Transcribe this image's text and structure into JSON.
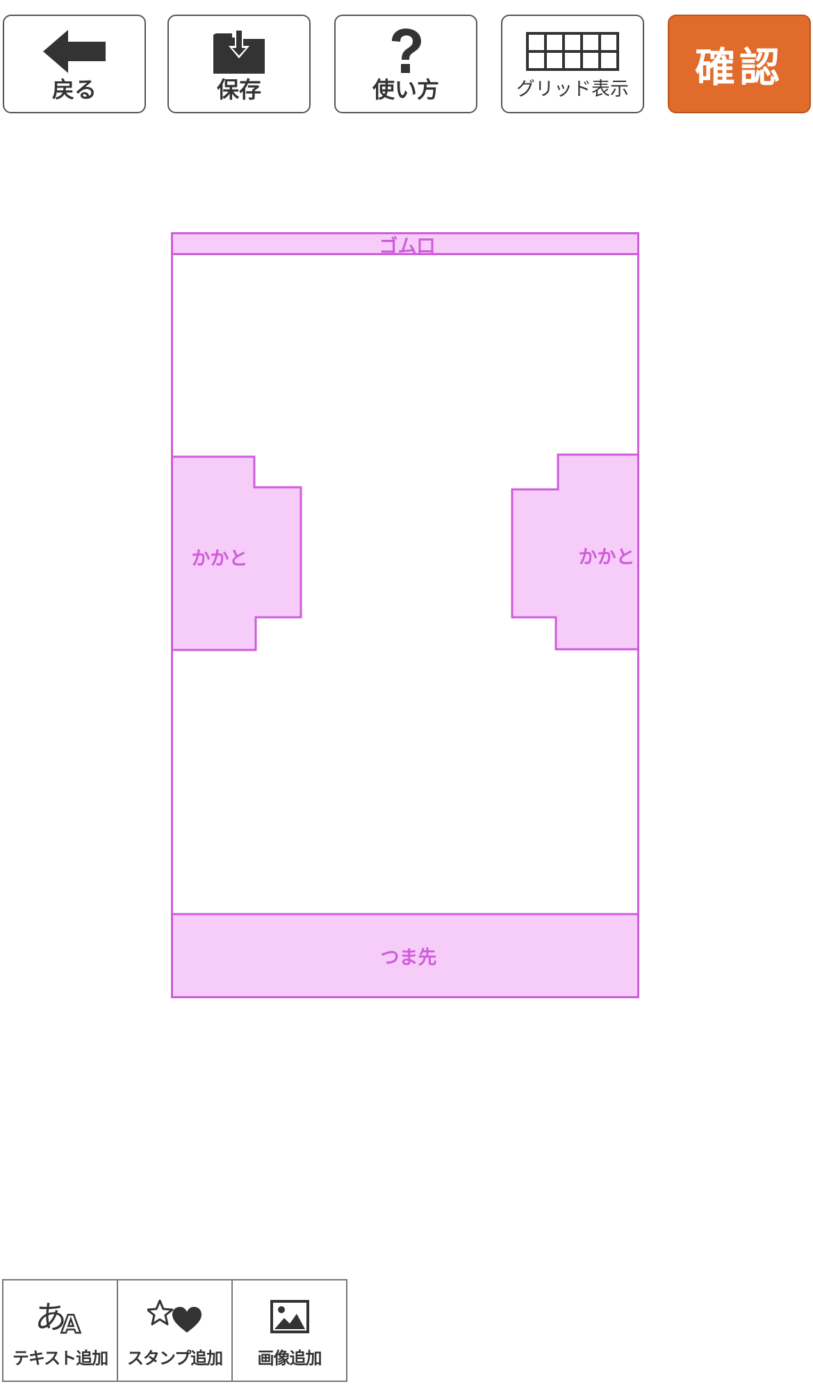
{
  "toolbar": {
    "back_label": "戻る",
    "save_label": "保存",
    "help_label": "使い方",
    "grid_label": "グリッド表示",
    "confirm_label": "確認"
  },
  "template": {
    "zones": {
      "top": "ゴム口",
      "heel_left": "かかと",
      "heel_right": "かかと",
      "toe": "つま先"
    }
  },
  "tools": {
    "text_label": "テキスト追加",
    "stamp_label": "スタンプ追加",
    "image_label": "画像追加"
  },
  "colors": {
    "confirm_bg": "#e06b2b",
    "zone_fill": "#f5cdf8",
    "zone_stroke": "#d05cdc",
    "icon_dark": "#333333"
  }
}
